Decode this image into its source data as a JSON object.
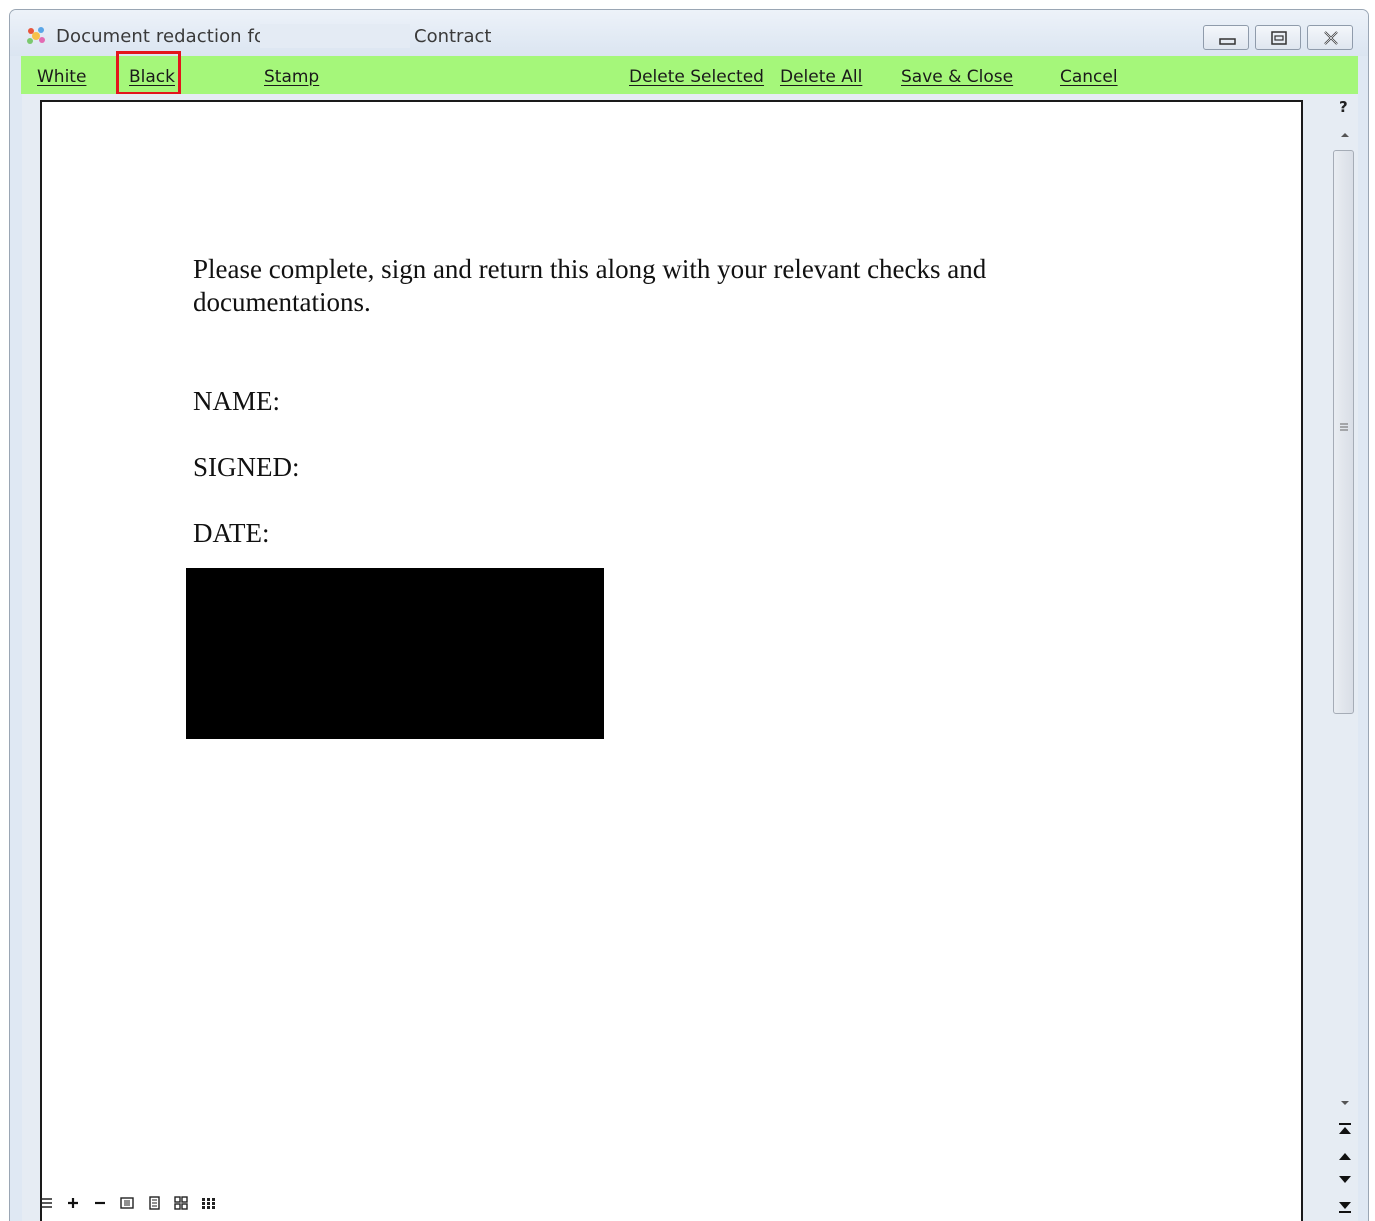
{
  "window": {
    "title_prefix": "Document redaction for",
    "title_document": "Contract"
  },
  "toolbar": {
    "white": "White",
    "black": "Black",
    "stamp": "Stamp",
    "delete_selected": "Delete Selected",
    "delete_all": "Delete All",
    "save_close": "Save & Close",
    "cancel": "Cancel",
    "selected_tool": "Black",
    "background_color": "#a5f77a",
    "highlight_color": "#e3151b"
  },
  "document": {
    "instruction_line1": "Please complete, sign and return this along with your relevant checks and",
    "instruction_line2": "documentations.",
    "name_label": "NAME:",
    "signed_label": "SIGNED:",
    "date_label": "DATE:",
    "redaction_color": "#000000"
  },
  "scrollbar": {
    "help": "?"
  },
  "icons": [
    "app-icon",
    "minimize-icon",
    "restore-icon",
    "close-icon",
    "help-icon",
    "scroll-up-icon",
    "scroll-down-icon",
    "first-page-icon",
    "previous-page-icon",
    "next-page-icon",
    "last-page-icon",
    "menu-icon",
    "zoom-in-icon",
    "zoom-out-icon",
    "fit-width-icon",
    "single-page-icon",
    "two-page-icon",
    "thumbnails-icon"
  ]
}
